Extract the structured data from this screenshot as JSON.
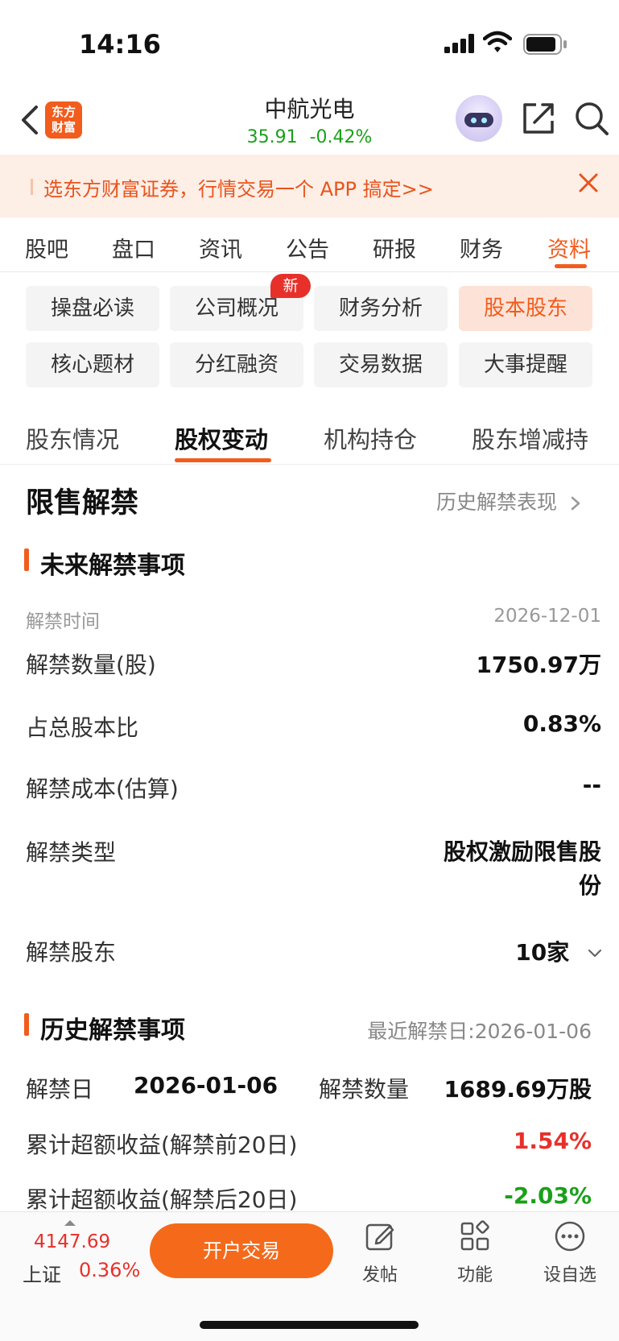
{
  "status_bar": {
    "time": "14:16"
  },
  "header": {
    "logo_line1": "东方",
    "logo_line2": "财富",
    "stock_name": "中航光电",
    "price": "35.91",
    "change_pct": "-0.42%"
  },
  "promo": {
    "text": "选东方财富证券，行情交易一个 APP 搞定>>"
  },
  "main_tabs": [
    "股吧",
    "盘口",
    "资讯",
    "公告",
    "研报",
    "财务",
    "资料"
  ],
  "chips": [
    "操盘必读",
    "公司概况",
    "财务分析",
    "股本股东",
    "核心题材",
    "分红融资",
    "交易数据",
    "大事提醒"
  ],
  "new_badge": "新",
  "sub_tabs": [
    "股东情况",
    "股权变动",
    "机构持仓",
    "股东增减持"
  ],
  "section": {
    "title": "限售解禁",
    "history_link": "历史解禁表现"
  },
  "future": {
    "heading": "未来解禁事项",
    "time_label": "解禁时间",
    "time_value": "2026-12-01",
    "rows": [
      {
        "label": "解禁数量(股)",
        "value": "1750.97万"
      },
      {
        "label": "占总股本比",
        "value": "0.83%"
      },
      {
        "label": "解禁成本(估算)",
        "value": "--"
      },
      {
        "label": "解禁类型",
        "value_line1": "股权激励限售股",
        "value_line2": "份"
      },
      {
        "label": "解禁股东",
        "value": "10家"
      }
    ]
  },
  "history": {
    "heading": "历史解禁事项",
    "recent": "最近解禁日:2026-01-06",
    "date_label": "解禁日",
    "date_value": "2026-01-06",
    "qty_label": "解禁数量",
    "qty_value": "1689.69万股",
    "excess_before_label": "累计超额收益(解禁前20日)",
    "excess_before_value": "1.54%",
    "excess_after_label": "累计超额收益(解禁后20日)",
    "excess_after_value": "-2.03%"
  },
  "bottom": {
    "index_value": "4147.69",
    "index_name": "上证",
    "index_change": "0.36%",
    "open_button": "开户交易",
    "tools": [
      "发帖",
      "功能",
      "设自选"
    ]
  },
  "colors": {
    "accent": "#f25c1d",
    "up": "#e8302a",
    "down": "#1aa01a"
  }
}
